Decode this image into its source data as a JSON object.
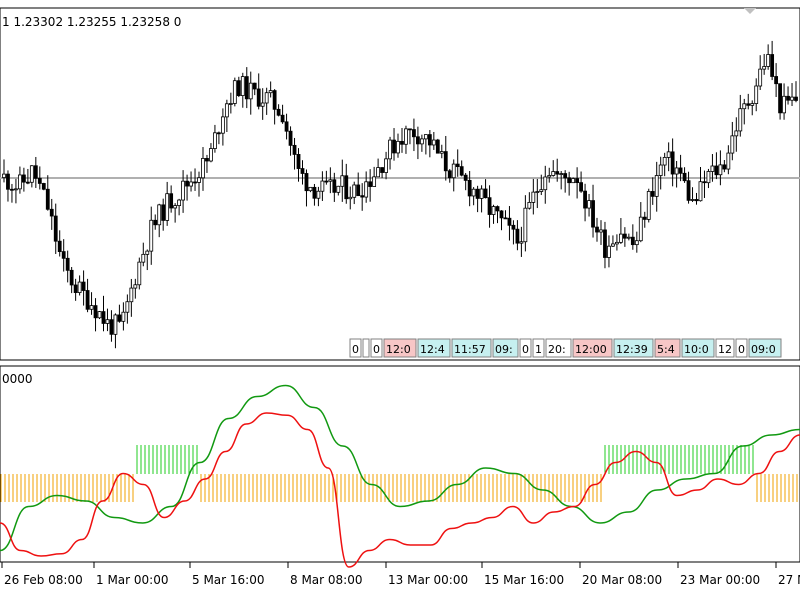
{
  "main_pane": {
    "ohlc_header": "1 1.23302 1.23255 1.23258  0",
    "horizontal_line_level": "1.23258",
    "session_labels": [
      {
        "text": "0",
        "color": "#ffffff"
      },
      {
        "text": "",
        "color": "#ffffff"
      },
      {
        "text": "0",
        "color": "#ffffff"
      },
      {
        "text": "12:0",
        "color": "#f7c6c6"
      },
      {
        "text": "12:4",
        "color": "#c6f0f0"
      },
      {
        "text": "11:57",
        "color": "#c6f0f0"
      },
      {
        "text": "09:",
        "color": "#c6f0f0"
      },
      {
        "text": "0",
        "color": "#ffffff"
      },
      {
        "text": "1",
        "color": "#ffffff"
      },
      {
        "text": "20:",
        "color": "#ffffff"
      },
      {
        "text": "12:00",
        "color": "#f7c6c6"
      },
      {
        "text": "12:39",
        "color": "#c6f0f0"
      },
      {
        "text": "5:4",
        "color": "#f7c6c6"
      },
      {
        "text": "10:0",
        "color": "#c6f0f0"
      },
      {
        "text": "12",
        "color": "#ffffff"
      },
      {
        "text": "0",
        "color": "#ffffff"
      },
      {
        "text": "09:0",
        "color": "#c6f0f0"
      }
    ]
  },
  "indicator_pane": {
    "header": "0000",
    "colors": {
      "fast_line": "#ee1111",
      "slow_line": "#119911",
      "histogram_up": "#22cc22",
      "histogram_down": "#f0a000"
    }
  },
  "time_axis": {
    "labels": [
      "26 Feb 08:00",
      "1 Mar 00:00",
      "5 Mar 16:00",
      "8 Mar 08:00",
      "13 Mar 00:00",
      "15 Mar 16:00",
      "20 Mar 08:00",
      "23 Mar 00:00",
      "27 M"
    ]
  },
  "chart_data": {
    "type": "candlestick",
    "close_trend": [
      1.2322,
      1.2318,
      1.2325,
      1.2309,
      1.2284,
      1.2274,
      1.2268,
      1.2259,
      1.2257,
      1.2281,
      1.2299,
      1.231,
      1.2316,
      1.2323,
      1.233,
      1.2353,
      1.2362,
      1.2358,
      1.2356,
      1.235,
      1.2325,
      1.2318,
      1.2316,
      1.2318,
      1.2316,
      1.2322,
      1.2331,
      1.234,
      1.2342,
      1.2338,
      1.2328,
      1.2322,
      1.2317,
      1.2309,
      1.2302,
      1.2294,
      1.2312,
      1.2327,
      1.2321,
      1.2324,
      1.2306,
      1.2292,
      1.23,
      1.2292,
      1.2314,
      1.233,
      1.2325,
      1.231,
      1.2323,
      1.2327,
      1.2346,
      1.2358,
      1.2375,
      1.2352,
      1.2356
    ],
    "indicator_fast": [
      -0.3,
      -0.55,
      -0.6,
      -0.58,
      -0.45,
      -0.1,
      0.15,
      0.05,
      -0.25,
      -0.1,
      0.1,
      0.35,
      0.6,
      0.7,
      0.68,
      0.55,
      0.2,
      -0.7,
      -0.55,
      -0.45,
      -0.5,
      -0.5,
      -0.35,
      -0.3,
      -0.25,
      -0.15,
      -0.3,
      -0.2,
      -0.15,
      0.05,
      0.25,
      0.35,
      0.25,
      -0.05,
      0.0,
      0.1,
      0.05,
      0.15,
      0.35,
      0.5
    ],
    "indicator_slow": [
      -0.55,
      -0.15,
      -0.05,
      -0.1,
      -0.25,
      -0.3,
      -0.15,
      0.25,
      0.65,
      0.85,
      0.95,
      0.75,
      0.4,
      0.05,
      -0.15,
      -0.1,
      0.05,
      0.2,
      0.15,
      0.0,
      -0.15,
      -0.3,
      -0.2,
      0.0,
      0.1,
      0.15,
      0.4,
      0.5,
      0.55
    ],
    "histogram": [
      -1,
      -1,
      -1,
      -1,
      -1,
      -1,
      -1,
      -1,
      -1,
      1,
      1,
      1,
      1,
      -1,
      -1,
      -1,
      -1,
      -1,
      -1,
      -1,
      -1,
      -1,
      -1,
      -1,
      -1,
      -1,
      -1,
      -1,
      -1,
      -1,
      -1,
      -1,
      -1,
      -1,
      -1,
      -1,
      -1,
      -1,
      -1,
      -1,
      1,
      1,
      1,
      1,
      1,
      1,
      1,
      1,
      1,
      1,
      -1,
      -1,
      -1
    ]
  }
}
